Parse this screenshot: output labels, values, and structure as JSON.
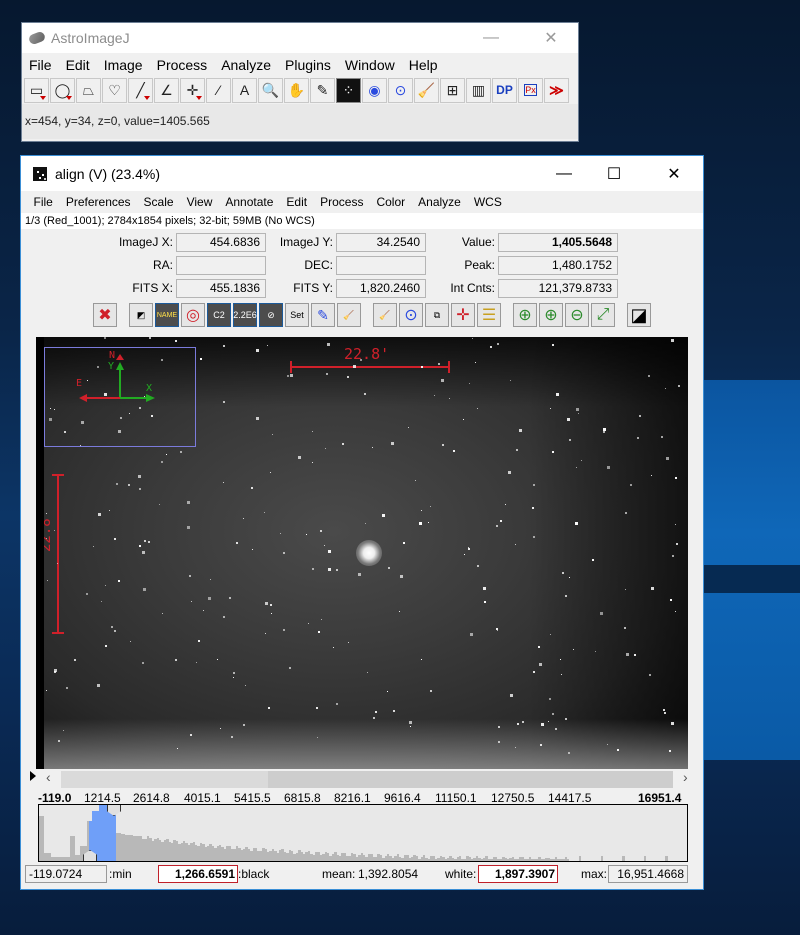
{
  "main_window": {
    "title": "AstroImageJ",
    "controls": {
      "minimize": "—",
      "maximize": "☐",
      "close": "✕"
    },
    "menu": [
      "File",
      "Edit",
      "Image",
      "Process",
      "Analyze",
      "Plugins",
      "Window",
      "Help"
    ],
    "tools": [
      {
        "name": "rectangle-tool",
        "glyph": "▭"
      },
      {
        "name": "oval-tool",
        "glyph": "◯"
      },
      {
        "name": "polygon-tool",
        "glyph": "⏢"
      },
      {
        "name": "freehand-tool",
        "glyph": "♡"
      },
      {
        "name": "line-tool",
        "glyph": "╱"
      },
      {
        "name": "angle-tool",
        "glyph": "∠"
      },
      {
        "name": "point-tool",
        "glyph": "✛"
      },
      {
        "name": "wand-tool",
        "glyph": "⁄"
      },
      {
        "name": "text-tool",
        "glyph": "A"
      },
      {
        "name": "magnifier-tool",
        "glyph": "🔍"
      },
      {
        "name": "scroll-tool",
        "glyph": "✋"
      },
      {
        "name": "color-picker-tool",
        "glyph": "✎"
      },
      {
        "name": "astro-tool",
        "glyph": "⁘"
      },
      {
        "name": "aperture-tool",
        "glyph": "◉"
      },
      {
        "name": "multi-aperture-tool",
        "glyph": "⊙"
      },
      {
        "name": "clear-tool",
        "glyph": "🧹"
      },
      {
        "name": "plot-tool",
        "glyph": "⊞"
      },
      {
        "name": "table-tool",
        "glyph": "▥"
      },
      {
        "name": "dp-tool",
        "glyph": "DP"
      },
      {
        "name": "pixel-inspector-tool",
        "glyph": "Px"
      },
      {
        "name": "more-tools",
        "glyph": "≫"
      }
    ],
    "status": "x=454, y=34, z=0, value=1405.565"
  },
  "image_window": {
    "title": "align (V) (23.4%)",
    "controls": {
      "minimize": "—",
      "maximize": "☐",
      "close": "✕"
    },
    "menu": [
      "File",
      "Preferences",
      "Scale",
      "View",
      "Annotate",
      "Edit",
      "Process",
      "Color",
      "Analyze",
      "WCS"
    ],
    "info": "1/3 (Red_1001); 2784x1854 pixels; 32-bit; 59MB (No WCS)",
    "coords": {
      "imagej_x": {
        "label": "ImageJ X:",
        "value": "454.6836"
      },
      "imagej_y": {
        "label": "ImageJ Y:",
        "value": "34.2540"
      },
      "value": {
        "label": "Value:",
        "value": "1,405.5648"
      },
      "ra": {
        "label": "RA:",
        "value": ""
      },
      "dec": {
        "label": "DEC:",
        "value": ""
      },
      "peak": {
        "label": "Peak:",
        "value": "1,480.1752"
      },
      "fits_x": {
        "label": "FITS X:",
        "value": "455.1836"
      },
      "fits_y": {
        "label": "FITS Y:",
        "value": "1,820.2460"
      },
      "int_cnts": {
        "label": "Int Cnts:",
        "value": "121,379.8733"
      }
    },
    "toolbar": [
      {
        "name": "clear-overlay-button",
        "glyph": "✖"
      },
      {
        "name": "invert-button",
        "glyph": "◩"
      },
      {
        "name": "show-name-button",
        "glyph": "NAME"
      },
      {
        "name": "show-aperture-button",
        "glyph": "◎"
      },
      {
        "name": "centroid-button",
        "glyph": "C2"
      },
      {
        "name": "gain-button",
        "glyph": "2.2E6"
      },
      {
        "name": "remove-star-button",
        "glyph": "⊘"
      },
      {
        "name": "set-aperture-button",
        "glyph": "Set"
      },
      {
        "name": "edit-apertures-button",
        "glyph": "✎"
      },
      {
        "name": "clear-apertures-button",
        "glyph": "🧹"
      },
      {
        "name": "clear-table-button",
        "glyph": "🧹"
      },
      {
        "name": "multi-aperture-button",
        "glyph": "⊙"
      },
      {
        "name": "stack-align-button",
        "glyph": "⧉"
      },
      {
        "name": "crosshair-button",
        "glyph": "✛"
      },
      {
        "name": "measurements-table-button",
        "glyph": "☰"
      },
      {
        "name": "zoom-in-fast-button",
        "glyph": "⊕"
      },
      {
        "name": "zoom-in-button",
        "glyph": "⊕"
      },
      {
        "name": "zoom-out-button",
        "glyph": "⊖"
      },
      {
        "name": "zoom-fit-button",
        "glyph": "⤢"
      },
      {
        "name": "contrast-button",
        "glyph": "◪"
      }
    ],
    "annotations": {
      "scale_horizontal": "22.8'",
      "scale_vertical": "22.8'",
      "compass": {
        "north": "N",
        "east": "E",
        "x": "X",
        "y": "Y"
      }
    },
    "histogram": {
      "ticks": [
        "-119.0",
        "1214.5",
        "2614.8",
        "4015.1",
        "5415.5",
        "6815.8",
        "8216.1",
        "9616.4",
        "11150.1",
        "12750.5",
        "14417.5",
        "16951.4"
      ],
      "min_value": "-119.0724",
      "min_label": ":min",
      "black_value": "1,266.6591",
      "black_label": ":black",
      "mean_label": "mean:",
      "mean_value": "1,392.8054",
      "white_label": "white:",
      "white_value": "1,897.3907",
      "max_label": "max:",
      "max_value": "16,951.4668"
    }
  },
  "colors": {
    "accent_red": "#d0202a",
    "histogram_selected": "#6f9ff8",
    "window_border": "#3b8fd6"
  }
}
